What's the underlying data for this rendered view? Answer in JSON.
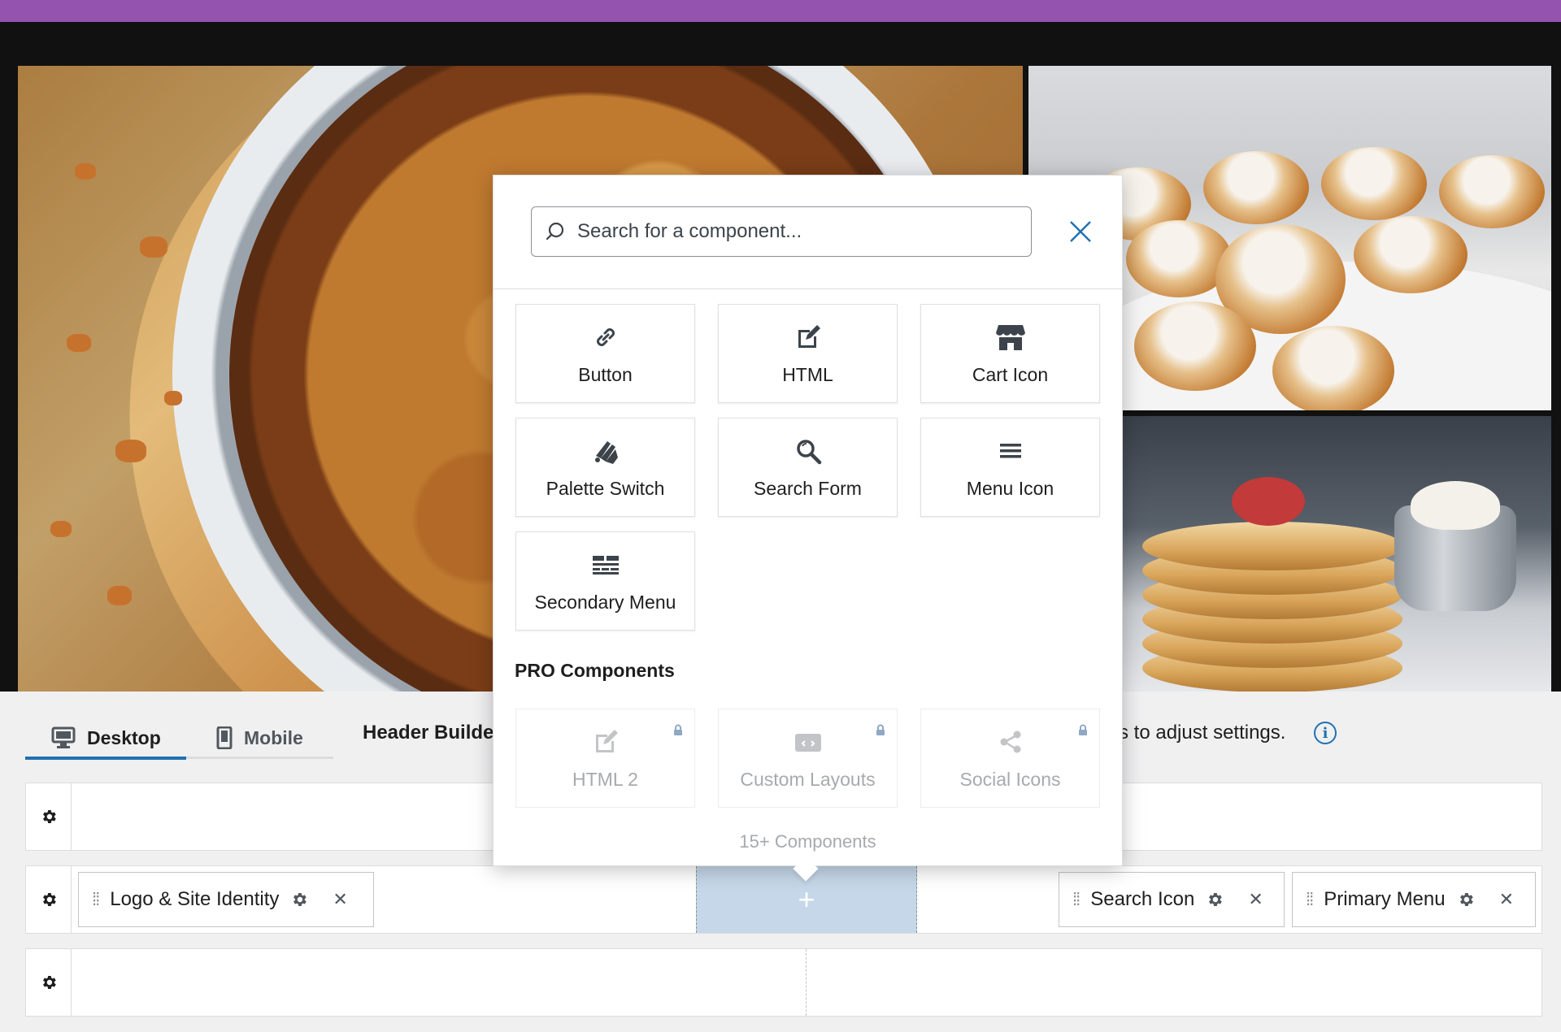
{
  "colors": {
    "top_bar": "#9553b0",
    "accent": "#2271b1",
    "drop_zone": "#c5d7e8",
    "muted_text": "#a7aaad"
  },
  "tabs": [
    {
      "label": "Desktop",
      "icon": "desktop-icon",
      "active": true
    },
    {
      "label": "Mobile",
      "icon": "mobile-icon",
      "active": false
    }
  ],
  "builder": {
    "title": "Header Builde",
    "hint": "s to adjust settings."
  },
  "picker": {
    "search_placeholder": "Search for a component...",
    "components": [
      {
        "label": "Button",
        "icon": "link-icon"
      },
      {
        "label": "HTML",
        "icon": "edit-icon"
      },
      {
        "label": "Cart Icon",
        "icon": "store-icon"
      },
      {
        "label": "Palette Switch",
        "icon": "palette-switch-icon"
      },
      {
        "label": "Search Form",
        "icon": "search-icon"
      },
      {
        "label": "Menu Icon",
        "icon": "menu-icon"
      },
      {
        "label": "Secondary Menu",
        "icon": "secondary-menu-icon"
      }
    ],
    "pro_heading": "PRO Components",
    "pro_components": [
      {
        "label": "HTML 2",
        "icon": "edit-icon"
      },
      {
        "label": "Custom Layouts",
        "icon": "layout-icon"
      },
      {
        "label": "Social Icons",
        "icon": "share-icon"
      }
    ],
    "more": "15+ Components"
  },
  "rows": {
    "main": {
      "left": [
        {
          "label": "Logo & Site Identity"
        }
      ],
      "right": [
        {
          "label": "Search Icon"
        },
        {
          "label": "Primary Menu"
        }
      ],
      "drop_symbol": "+"
    }
  }
}
